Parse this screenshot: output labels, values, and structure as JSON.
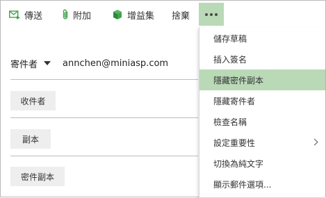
{
  "toolbar": {
    "send_label": "傳送",
    "attach_label": "附加",
    "addins_label": "增益集",
    "discard_label": "捨棄"
  },
  "compose": {
    "sender_label": "寄件者",
    "sender_email": "annchen@miniasp.com",
    "to_button": "收件者",
    "cc_button": "副本",
    "bcc_button": "密件副本"
  },
  "menu": {
    "items": [
      {
        "label": "儲存草稿"
      },
      {
        "label": "插入簽名"
      },
      {
        "label": "隱藏密件副本"
      },
      {
        "label": "隱藏寄件者"
      },
      {
        "label": "檢查名稱"
      },
      {
        "label": "設定重要性"
      },
      {
        "label": "切換為純文字"
      },
      {
        "label": "顯示郵件選項..."
      }
    ],
    "active_index": 2
  },
  "colors": {
    "accent_green": "#3ea34b",
    "highlight": "#b9d9b7"
  }
}
